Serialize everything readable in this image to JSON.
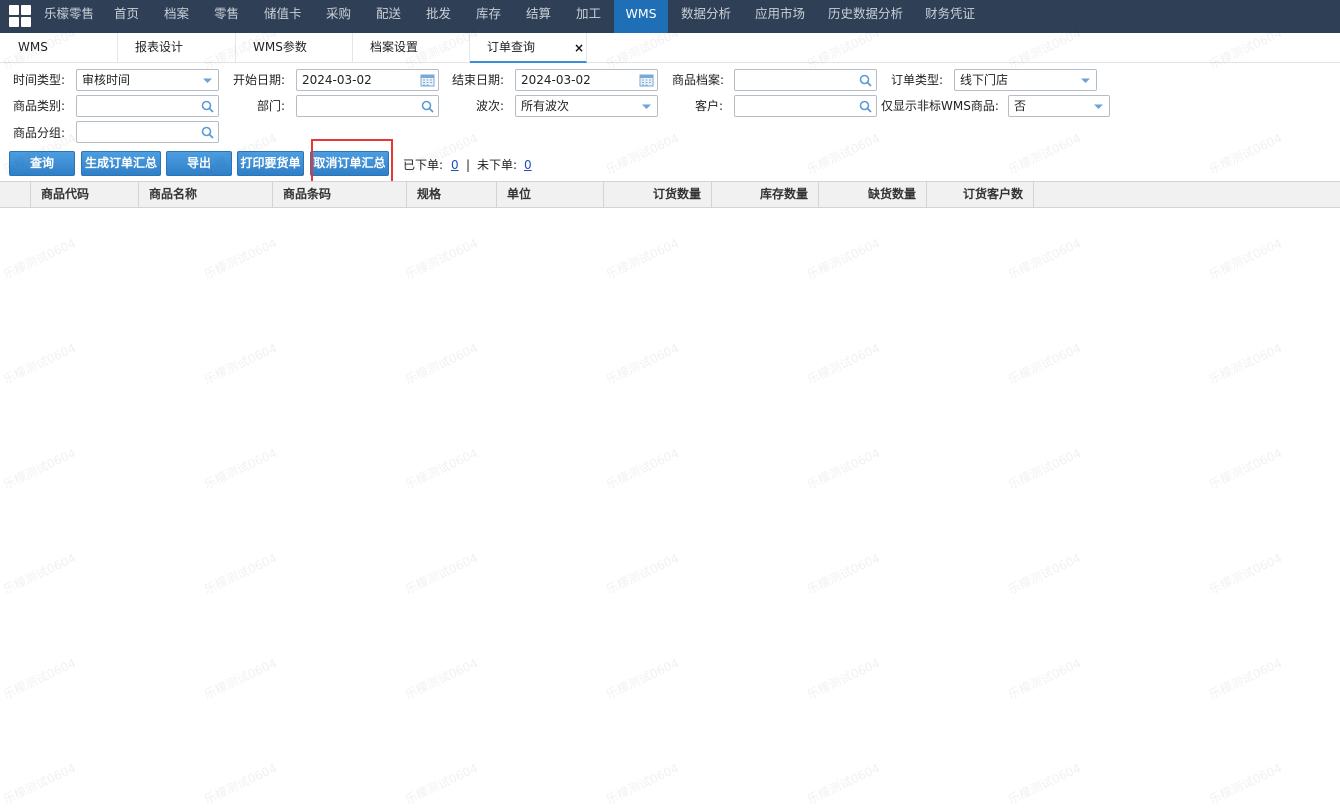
{
  "nav": {
    "items": [
      "乐檬零售",
      "首页",
      "档案",
      "零售",
      "储值卡",
      "采购",
      "配送",
      "批发",
      "库存",
      "结算",
      "加工",
      "WMS",
      "数据分析",
      "应用市场",
      "历史数据分析",
      "财务凭证"
    ],
    "active": "WMS"
  },
  "tabs": {
    "items": [
      "WMS",
      "报表设计",
      "WMS参数",
      "档案设置",
      "订单查询"
    ],
    "close": "×"
  },
  "filters": {
    "time_type_label": "时间类型:",
    "time_type_value": "审核时间",
    "start_label": "开始日期:",
    "start_value": "2024-03-02",
    "end_label": "结束日期:",
    "end_value": "2024-03-02",
    "product_file_label": "商品档案:",
    "product_file_value": "",
    "order_type_label": "订单类型:",
    "order_type_value": "线下门店",
    "category_label": "商品类别:",
    "category_value": "",
    "dept_label": "部门:",
    "dept_value": "",
    "wave_label": "波次:",
    "wave_value": "所有波次",
    "customer_label": "客户:",
    "customer_value": "",
    "non_wms_label": "仅显示非标WMS商品:",
    "non_wms_value": "否",
    "group_label": "商品分组:",
    "group_value": ""
  },
  "buttons": {
    "query": "查询",
    "generate": "生成订单汇总",
    "export": "导出",
    "print": "打印要货单",
    "cancel": "取消订单汇总"
  },
  "counters": {
    "ordered_label": "已下单:",
    "ordered_value": "0",
    "separator": "|",
    "not_ordered_label": "未下单:",
    "not_ordered_value": "0"
  },
  "grid": {
    "columns": [
      "商品代码",
      "商品名称",
      "商品条码",
      "规格",
      "单位",
      "订货数量",
      "库存数量",
      "缺货数量",
      "订货客户数"
    ]
  },
  "watermark": "乐檬测试0604",
  "colors": {
    "nav_bg": "#2f4056",
    "nav_active": "#1e6fb5",
    "button": "#3a89d0",
    "highlight": "#e53935"
  }
}
